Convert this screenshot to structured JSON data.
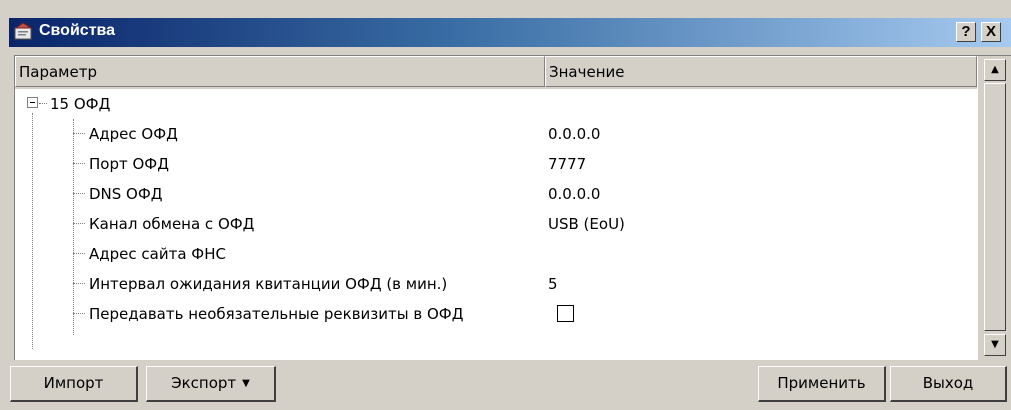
{
  "window": {
    "title": "Свойства",
    "help_label": "?",
    "close_label": "X"
  },
  "grid": {
    "columns": [
      "Параметр",
      "Значение"
    ],
    "group": {
      "label": "15 ОФД",
      "expanded": true
    },
    "rows": [
      {
        "name": "Адрес ОФД",
        "value": "0.0.0.0"
      },
      {
        "name": "Порт ОФД",
        "value": "7777"
      },
      {
        "name": "DNS ОФД",
        "value": "0.0.0.0"
      },
      {
        "name": "Канал обмена с ОФД",
        "value": "USB (EoU)"
      },
      {
        "name": "Адрес сайта ФНС",
        "value": ""
      },
      {
        "name": "Интервал ожидания квитанции ОФД (в мин.)",
        "value": "5"
      },
      {
        "name": "Передавать необязательные реквизиты в ОФД",
        "checked": false
      }
    ]
  },
  "scrollbar": {
    "up_label": "▲",
    "down_label": "▼"
  },
  "buttons": {
    "import": "Импорт",
    "export": "Экспорт",
    "export_arrow": "▼",
    "apply": "Применить",
    "exit": "Выход"
  },
  "icons": {
    "window_icon": "properties-window-icon"
  }
}
